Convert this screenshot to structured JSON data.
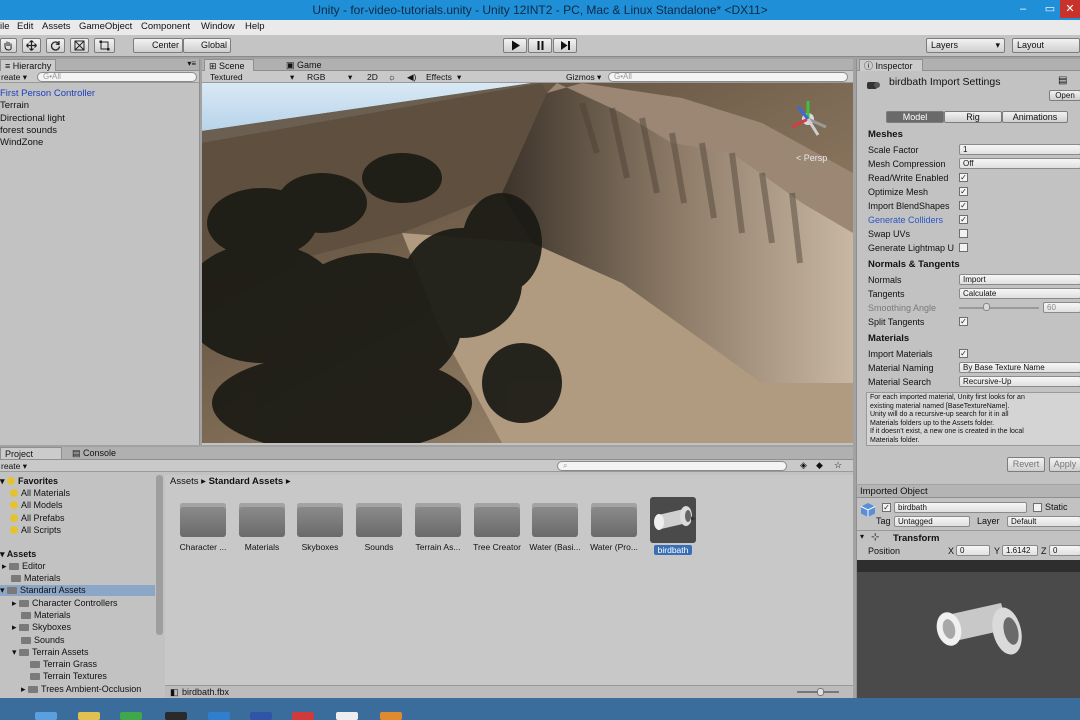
{
  "window": {
    "title": "Unity - for-video-tutorials.unity - Unity 12INT2 - PC, Mac & Linux Standalone* <DX11>",
    "min": "–",
    "max": "▭",
    "close": "✕"
  },
  "menu": [
    "ile",
    "Edit",
    "Assets",
    "GameObject",
    "Component",
    "Window",
    "Help"
  ],
  "toolbar": {
    "pivot_center": "Center",
    "pivot_global": "Global",
    "layers": "Layers",
    "layout": "Layout"
  },
  "hierarchy": {
    "tab": "Hierarchy",
    "create": "reate ▾",
    "search_placeholder": "G•All",
    "items": [
      "First Person Controller",
      "Terrain",
      "Directional light",
      "forest sounds",
      "WindZone"
    ]
  },
  "scene": {
    "tab_scene": "Scene",
    "tab_game": "Game",
    "shading": "Textured",
    "rgb": "RGB",
    "mode_2d": "2D",
    "effects": "Effects",
    "gizmos": "Gizmos",
    "search_placeholder": "G•All",
    "persp": "< Persp"
  },
  "inspector": {
    "tab": "Inspector",
    "title": "birdbath Import Settings",
    "open": "Open",
    "tabs": [
      "Model",
      "Rig",
      "Animations"
    ],
    "meshes_header": "Meshes",
    "scale_factor_label": "Scale Factor",
    "scale_factor_value": "1",
    "mesh_compression_label": "Mesh Compression",
    "mesh_compression_value": "Off",
    "read_write_label": "Read/Write Enabled",
    "optimize_mesh_label": "Optimize Mesh",
    "import_blendshapes_label": "Import BlendShapes",
    "generate_colliders_label": "Generate Colliders",
    "swap_uvs_label": "Swap UVs",
    "generate_lightmap_label": "Generate Lightmap U",
    "normals_header": "Normals & Tangents",
    "normals_label": "Normals",
    "normals_value": "Import",
    "tangents_label": "Tangents",
    "tangents_value": "Calculate",
    "smoothing_label": "Smoothing Angle",
    "smoothing_value": "60",
    "split_tangents_label": "Split Tangents",
    "materials_header": "Materials",
    "import_materials_label": "Import Materials",
    "material_naming_label": "Material Naming",
    "material_naming_value": "By Base Texture Name",
    "material_search_label": "Material Search",
    "material_search_value": "Recursive-Up",
    "help_lines": [
      "For each imported material, Unity first looks for an",
      "existing material named [BaseTextureName].",
      "Unity will do a recursive-up search for it in all",
      "Materials folders up to the Assets folder.",
      "If it doesn't exist, a new one is created in the local",
      "Materials folder."
    ],
    "revert": "Revert",
    "apply": "Apply"
  },
  "imported_object": {
    "header": "Imported Object",
    "name": "birdbath",
    "static": "Static",
    "tag_label": "Tag",
    "tag_value": "Untagged",
    "layer_label": "Layer",
    "layer_value": "Default",
    "transform": "Transform",
    "position_label": "Position",
    "x_label": "X",
    "x_value": "0",
    "y_label": "Y",
    "y_value": "1.6142",
    "z_label": "Z",
    "z_value": "0"
  },
  "project": {
    "tab_project": "Project",
    "tab_console": "Console",
    "create": "reate ▾",
    "breadcrumb_root": "Assets",
    "breadcrumb_sep": "▸",
    "breadcrumb_current": "Standard Assets",
    "favorites": "Favorites",
    "favorite_items": [
      "All Materials",
      "All Models",
      "All Prefabs",
      "All Scripts"
    ],
    "assets_root": "Assets",
    "tree": [
      "Editor",
      "Materials",
      "Standard Assets",
      "Character Controllers",
      "Materials",
      "Skyboxes",
      "Sounds",
      "Terrain Assets",
      "Terrain Grass",
      "Terrain Textures",
      "Trees Ambient-Occlusion"
    ],
    "asset_items": [
      "Character ...",
      "Materials",
      "Skyboxes",
      "Sounds",
      "Terrain As...",
      "Tree Creator",
      "Water (Basi...",
      "Water (Pro...",
      "birdbath"
    ],
    "status_file": "birdbath.fbx"
  }
}
